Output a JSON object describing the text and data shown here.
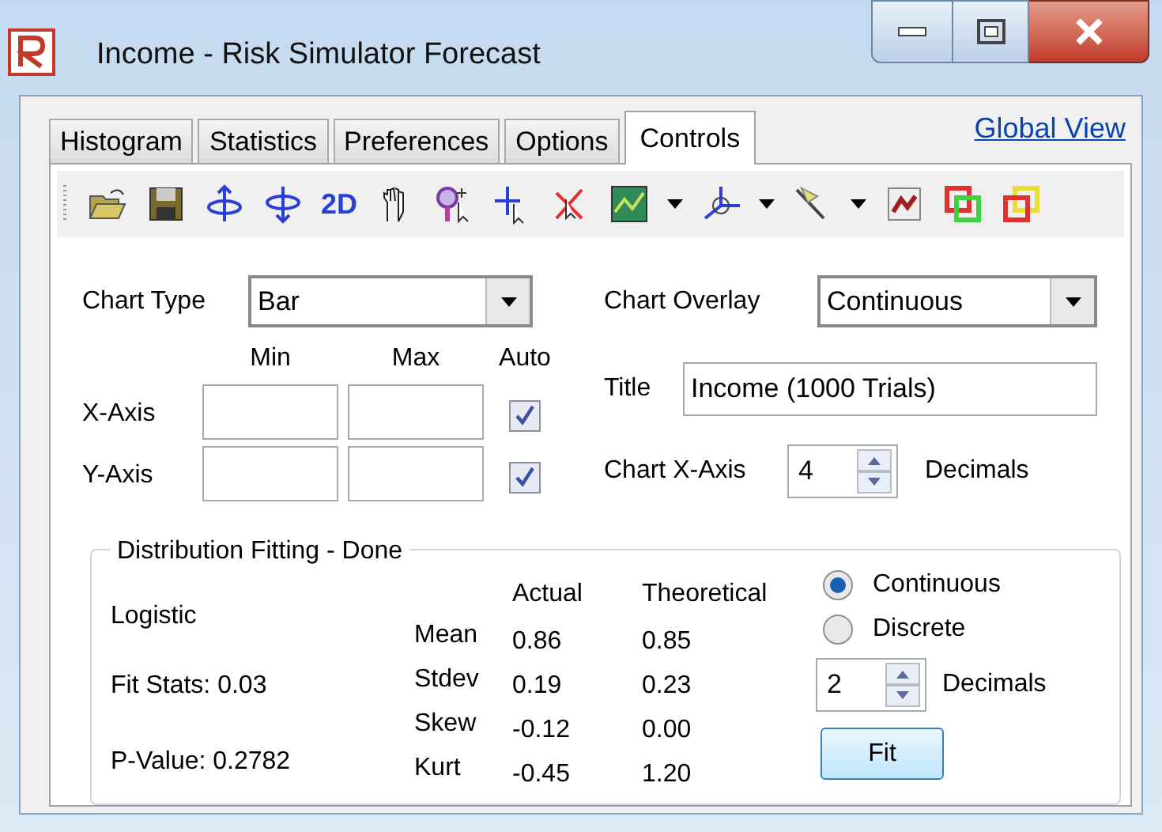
{
  "window": {
    "title": "Income - Risk Simulator Forecast"
  },
  "tabs": [
    {
      "label": "Histogram",
      "selected": false
    },
    {
      "label": "Statistics",
      "selected": false
    },
    {
      "label": "Preferences",
      "selected": false
    },
    {
      "label": "Options",
      "selected": false
    },
    {
      "label": "Controls",
      "selected": true
    }
  ],
  "global_view_link": "Global View",
  "toolbar": {
    "view_2d_button": "2D"
  },
  "chart_type": {
    "label": "Chart Type",
    "value": "Bar"
  },
  "chart_overlay": {
    "label": "Chart Overlay",
    "value": "Continuous"
  },
  "axis_columns": [
    "Min",
    "Max",
    "Auto"
  ],
  "axes": [
    {
      "label": "X-Axis",
      "auto_checked": true
    },
    {
      "label": "Y-Axis",
      "auto_checked": true
    }
  ],
  "title_field": {
    "label": "Title",
    "value": "Income (1000 Trials)"
  },
  "chart_x_axis": {
    "label": "Chart X-Axis",
    "value": "4",
    "suffix": "Decimals"
  },
  "fitting": {
    "title": "Distribution Fitting - Done",
    "distribution": "Logistic",
    "fit_stats": "Fit Stats: 0.03",
    "p_value": "P-Value: 0.2782",
    "columns": [
      "Actual",
      "Theoretical"
    ],
    "rows": [
      {
        "name": "Mean",
        "actual": "0.86",
        "theoretical": "0.85"
      },
      {
        "name": "Stdev",
        "actual": "0.19",
        "theoretical": "0.23"
      },
      {
        "name": "Skew",
        "actual": "-0.12",
        "theoretical": "0.00"
      },
      {
        "name": "Kurt",
        "actual": "-0.45",
        "theoretical": "1.20"
      }
    ],
    "options": [
      {
        "label": "Continuous",
        "selected": true
      },
      {
        "label": "Discrete",
        "selected": false
      }
    ],
    "decimals": {
      "value": "2",
      "suffix": "Decimals"
    },
    "fit_button": "Fit"
  }
}
